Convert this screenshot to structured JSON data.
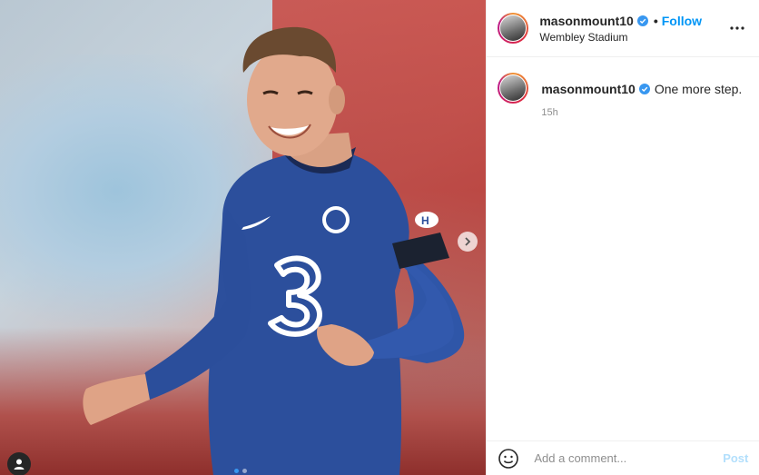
{
  "post": {
    "username": "masonmount10",
    "follow_label": "Follow",
    "bullet": "•",
    "location": "Wembley Stadium"
  },
  "caption": {
    "username": "masonmount10",
    "text": "One more step.",
    "timestamp": "15h"
  },
  "composer": {
    "placeholder": "Add a comment...",
    "post_label": "Post"
  },
  "carousel": {
    "slides": 2,
    "active_slide": 1
  },
  "shirt": {
    "sponsor_number": "3"
  },
  "icons": [
    "verified-badge-icon",
    "more-options-icon",
    "chevron-right-icon",
    "user-tag-icon",
    "emoji-icon"
  ],
  "colors": {
    "accent": "#0095f6",
    "post_disabled": "#b2dffc",
    "kit_blue": "#2c4f9c"
  }
}
